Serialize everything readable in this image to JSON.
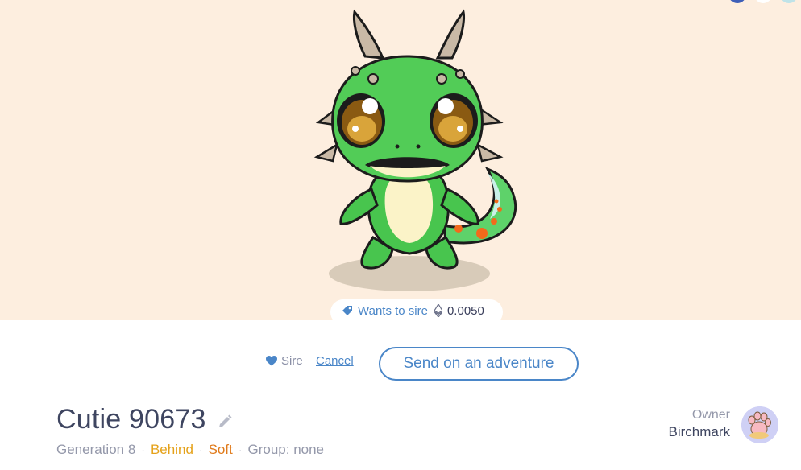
{
  "hero": {
    "creature_alt": "green dragon cutie",
    "listing": {
      "label": "Wants to sire",
      "price": "0.0050",
      "tag_icon": "tag-icon",
      "currency_icon": "ethereum-icon"
    }
  },
  "actions": {
    "sire_label": "Sire",
    "cancel_label": "Cancel",
    "adventure_label": "Send on an adventure"
  },
  "cutie": {
    "name": "Cutie 90673",
    "generation": "Generation 8",
    "speed": "Behind",
    "fur": "Soft",
    "group": "Group: none"
  },
  "owner": {
    "label": "Owner",
    "name": "Birchmark",
    "avatar_icon": "paw-icon"
  },
  "colors": {
    "hero_bg": "#fdeedf",
    "accent_blue": "#4a86c8",
    "speed_color": "#e5a21a",
    "fur_color": "#e07a1a"
  }
}
